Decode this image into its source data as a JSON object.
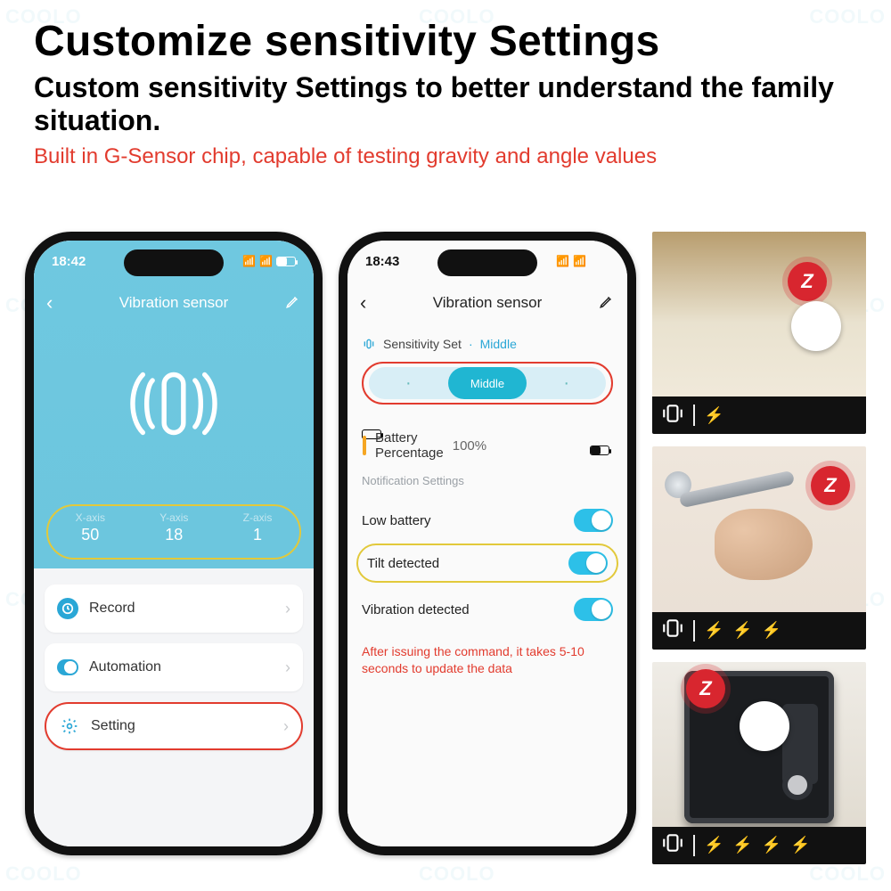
{
  "heading": {
    "title": "Customize sensitivity Settings",
    "subtitle": "Custom sensitivity Settings to better understand the family situation.",
    "note": "Built in G-Sensor chip, capable of testing gravity and angle values"
  },
  "phone1": {
    "time": "18:42",
    "title": "Vibration sensor",
    "axes": {
      "x": {
        "label": "X-axis",
        "value": "50"
      },
      "y": {
        "label": "Y-axis",
        "value": "18"
      },
      "z": {
        "label": "Z-axis",
        "value": "1"
      }
    },
    "cards": {
      "record": "Record",
      "automation": "Automation",
      "setting": "Setting"
    }
  },
  "phone2": {
    "time": "18:43",
    "title": "Vibration sensor",
    "sensitivity": {
      "label": "Sensitivity Set",
      "value": "Middle",
      "segment": {
        "selected": "Middle"
      }
    },
    "battery": {
      "label": "Battery Percentage",
      "value": "100%"
    },
    "notifHeader": "Notification Settings",
    "toggles": {
      "low": {
        "label": "Low battery",
        "on": true
      },
      "tilt": {
        "label": "Tilt detected",
        "on": true
      },
      "vib": {
        "label": "Vibration detected",
        "on": true
      }
    },
    "footnote": "After issuing the command, it takes 5-10 seconds to update the data"
  },
  "photos": {
    "bolts": [
      1,
      3,
      4
    ],
    "zb_glyph": "Z"
  },
  "brand_watermark": "COOLO"
}
